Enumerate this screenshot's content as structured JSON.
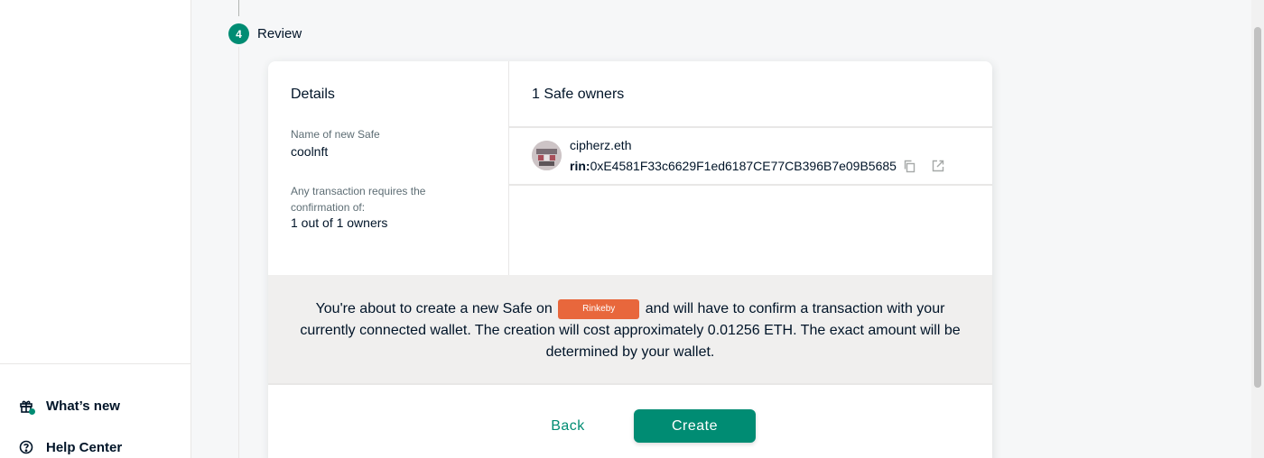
{
  "sidebar": {
    "whats_new": "What’s new",
    "help_center": "Help Center"
  },
  "stepper": {
    "step_number": "4",
    "step_label": "Review"
  },
  "details": {
    "title": "Details",
    "name_label": "Name of new Safe",
    "name_value": "coolnft",
    "threshold_label": "Any transaction requires the confirmation of:",
    "threshold_value": "1 out of 1 owners"
  },
  "owners": {
    "title": "1 Safe owners",
    "list": [
      {
        "name": "cipherz.eth",
        "prefix": "rin:",
        "address": "0xE4581F33c6629F1ed6187CE77CB396B7e09B5685"
      }
    ]
  },
  "info": {
    "text_before": "You're about to create a new Safe on",
    "network": "Rinkeby",
    "text_after": "and will have to confirm a transaction with your currently connected wallet. The creation will cost approximately 0.01256 ETH. The exact amount will be determined by your wallet."
  },
  "buttons": {
    "back": "Back",
    "create": "Create"
  },
  "colors": {
    "primary": "#008c73",
    "network_badge": "#e8673c"
  }
}
